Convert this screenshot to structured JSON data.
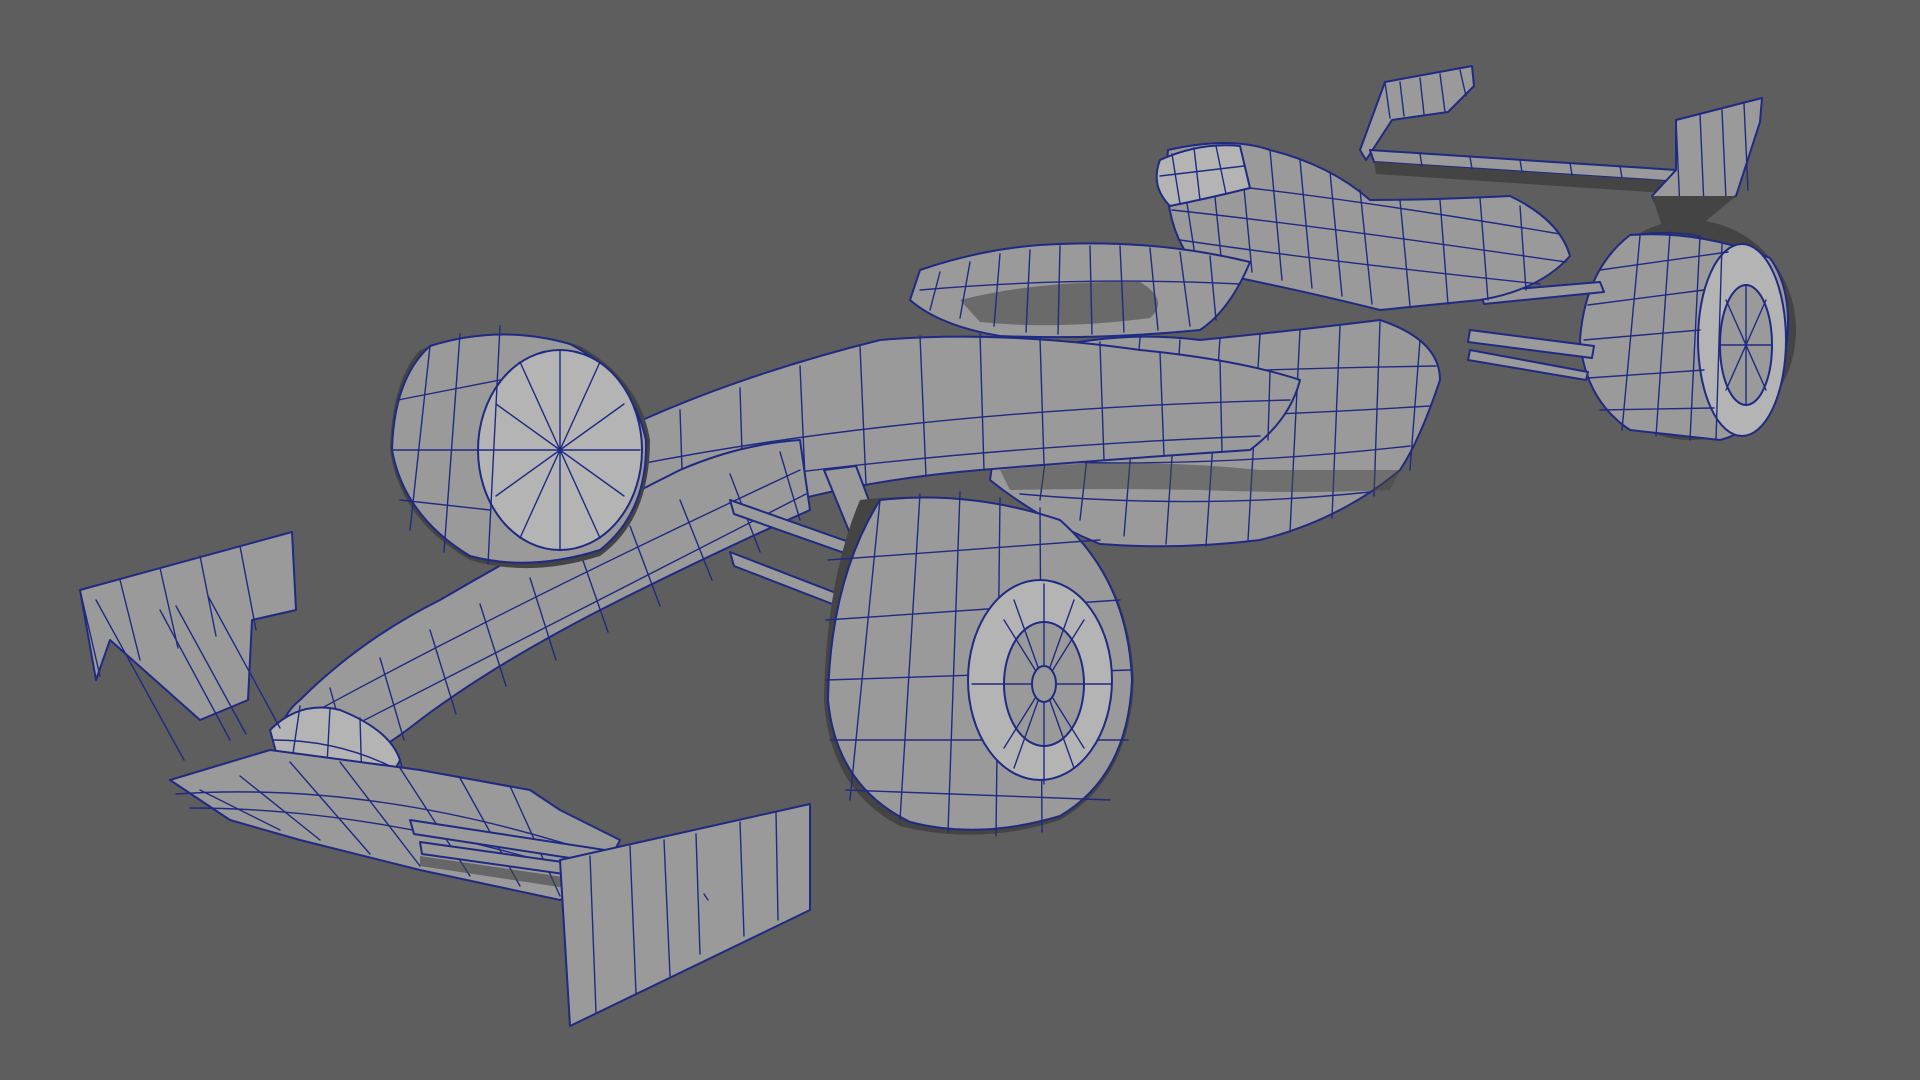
{
  "viewport": {
    "background_color": "#5e5e5e",
    "wireframe_color": "#1f2a82",
    "mesh_color": "#9a9a9a"
  },
  "scene": {
    "object": "formula-one-car-wireframe",
    "components": [
      "front-wing",
      "nose-cone",
      "chassis",
      "cockpit",
      "airbox",
      "sidepod",
      "rear-wing",
      "front-left-wheel",
      "front-right-wheel",
      "rear-right-wheel",
      "front-suspension",
      "rear-suspension"
    ]
  }
}
